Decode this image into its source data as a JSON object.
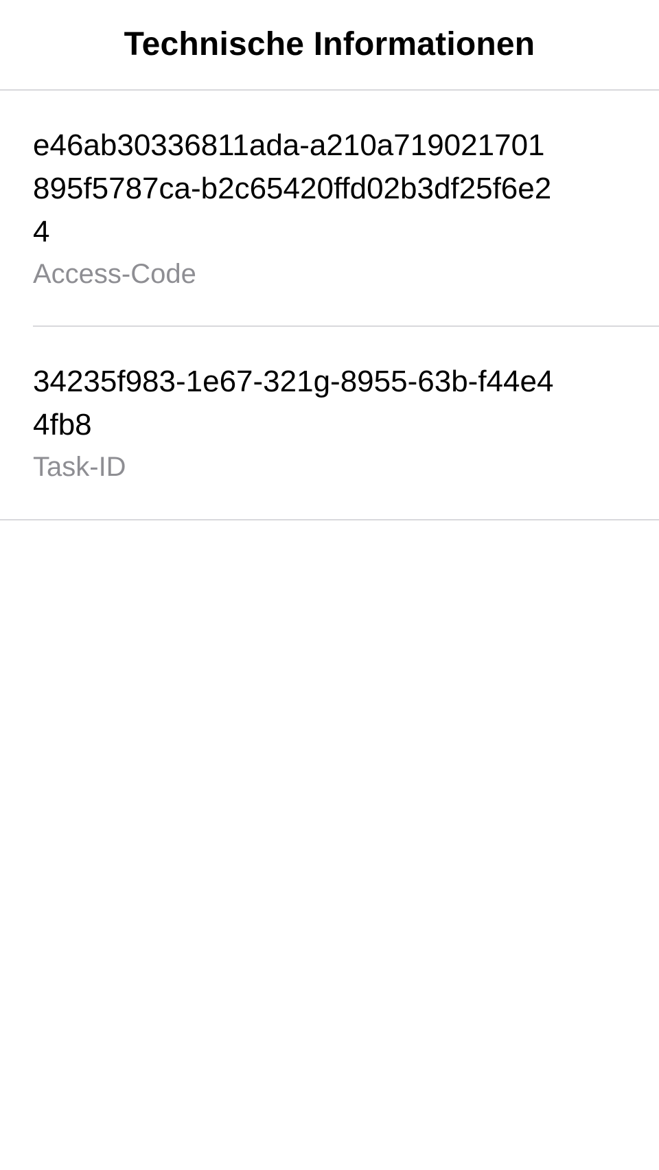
{
  "header": {
    "title": "Technische Informationen"
  },
  "items": [
    {
      "value": "e46ab30336811ada-a210a719021701895f5787ca-b2c65420ffd02b3df25f6e24",
      "label": "Access-Code"
    },
    {
      "value": "34235f983-1e67-321g-8955-63b-f44e44fb8",
      "label": "Task-ID"
    }
  ],
  "colors": {
    "primary_text": "#000000",
    "secondary_text": "#8e8e93",
    "separator": "#d8d8dc",
    "background": "#ffffff"
  }
}
